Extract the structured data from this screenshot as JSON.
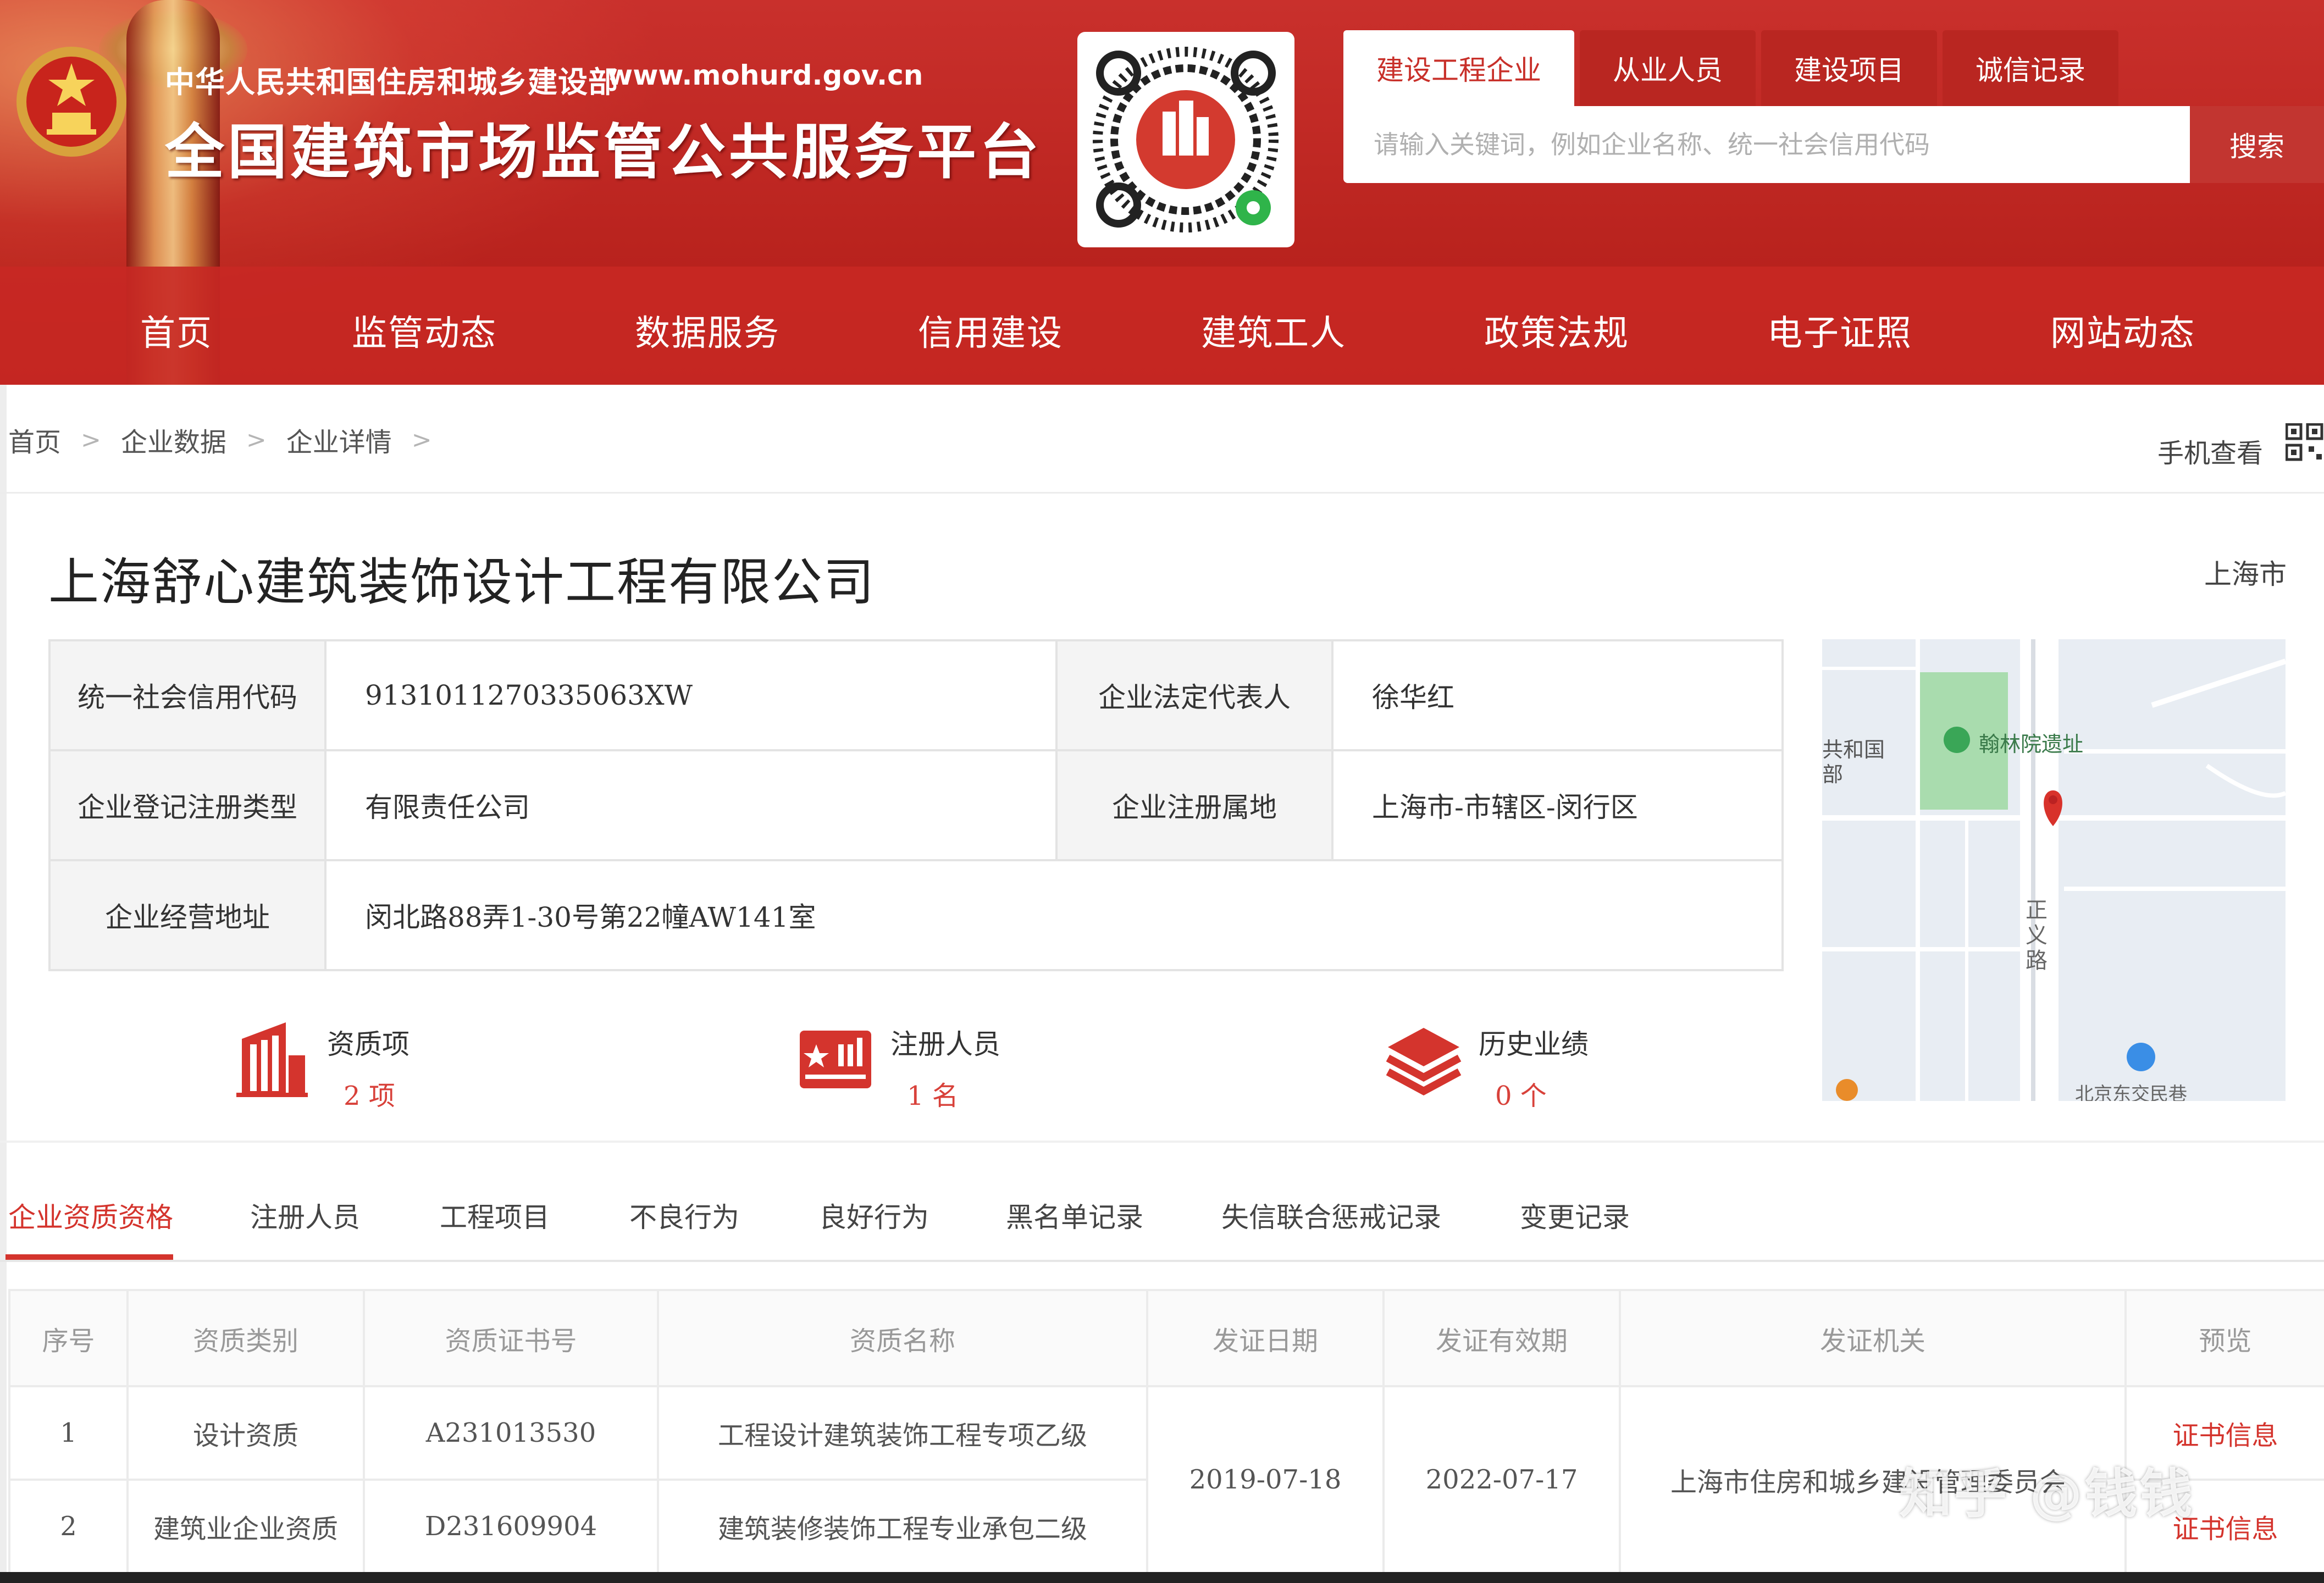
{
  "header": {
    "ministry": "中华人民共和国住房和城乡建设部",
    "url": "www.mohurd.gov.cn",
    "title": "全国建筑市场监管公共服务平台",
    "search_tabs": [
      "建设工程企业",
      "从业人员",
      "建设项目",
      "诚信记录"
    ],
    "search_placeholder": "请输入关键词，例如企业名称、统一社会信用代码",
    "search_button": "搜索"
  },
  "nav": [
    "首页",
    "监管动态",
    "数据服务",
    "信用建设",
    "建筑工人",
    "政策法规",
    "电子证照",
    "网站动态"
  ],
  "breadcrumb": [
    "首页",
    "企业数据",
    "企业详情"
  ],
  "mobile_view": "手机查看",
  "company": {
    "name": "上海舒心建筑装饰设计工程有限公司",
    "city": "上海市",
    "credit_code_label": "统一社会信用代码",
    "credit_code": "9131011270335063XW",
    "legal_rep_label": "企业法定代表人",
    "legal_rep": "徐华红",
    "reg_type_label": "企业登记注册类型",
    "reg_type": "有限责任公司",
    "reg_place_label": "企业注册属地",
    "reg_place": "上海市-市辖区-闵行区",
    "address_label": "企业经营地址",
    "address": "闵北路88弄1-30号第22幢AW141室"
  },
  "map": {
    "label_gov": "共和国",
    "label_gov2": "部",
    "poi": "翰林院遗址",
    "road": "正义路",
    "bottom": "北京东交民巷"
  },
  "stats": [
    {
      "label": "资质项",
      "value": "2 项",
      "icon": "building-icon"
    },
    {
      "label": "注册人员",
      "value": "1 名",
      "icon": "id-card-icon"
    },
    {
      "label": "历史业绩",
      "value": "0 个",
      "icon": "layers-icon"
    }
  ],
  "subtabs": [
    "企业资质资格",
    "注册人员",
    "工程项目",
    "不良行为",
    "良好行为",
    "黑名单记录",
    "失信联合惩戒记录",
    "变更记录"
  ],
  "table": {
    "headers": [
      "序号",
      "资质类别",
      "资质证书号",
      "资质名称",
      "发证日期",
      "发证有效期",
      "发证机关",
      "预览"
    ],
    "rows": [
      {
        "no": "1",
        "category": "设计资质",
        "cert_no": "A231013530",
        "name": "工程设计建筑装饰工程专项乙级",
        "preview": "证书信息"
      },
      {
        "no": "2",
        "category": "建筑业企业资质",
        "cert_no": "D231609904",
        "name": "建筑装修装饰工程专业承包二级",
        "preview": "证书信息"
      }
    ],
    "issue_date": "2019-07-18",
    "valid_until": "2022-07-17",
    "authority": "上海市住房和城乡建设管理委员会"
  },
  "watermark": "知乎 @钱钱",
  "colors": {
    "brand_red": "#c9302c",
    "link_red": "#d4342d"
  }
}
